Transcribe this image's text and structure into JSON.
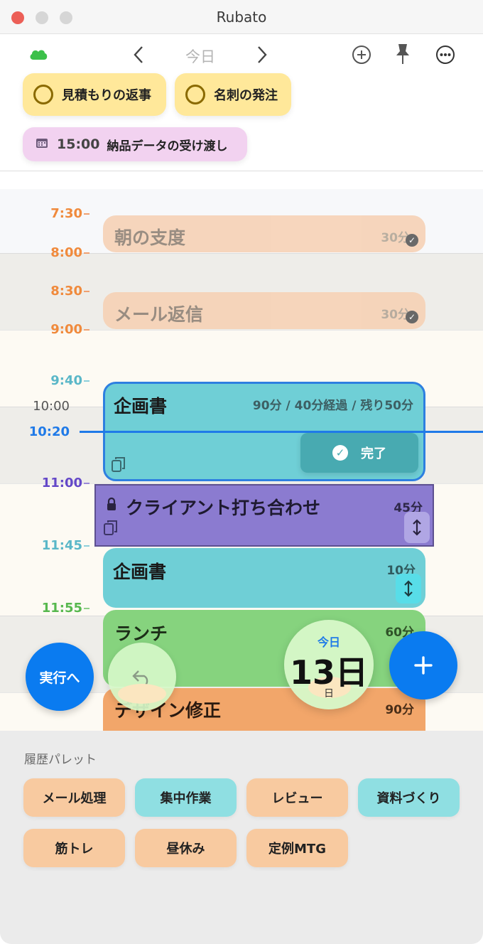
{
  "window": {
    "title": "Rubato"
  },
  "toolbar": {
    "date_label": "今日",
    "prev_icon": "chevron-left-icon",
    "next_icon": "chevron-right-icon"
  },
  "todos": [
    {
      "label": "見積もりの返事"
    },
    {
      "label": "名刺の発注"
    }
  ],
  "scheduled": {
    "time": "15:00",
    "label": "納品データの受け渡し"
  },
  "time_labels": {
    "t0730": "7:30",
    "t0800": "8:00",
    "t0830": "8:30",
    "t0900": "9:00",
    "t0940": "9:40",
    "t1000": "10:00",
    "t1020": "10:20",
    "t1100": "11:00",
    "t1145": "11:45",
    "t1155": "11:55"
  },
  "events": {
    "breakfast": {
      "title": "朝の支度",
      "duration": "30分"
    },
    "mail": {
      "title": "メール返信",
      "duration": "30分"
    },
    "plan": {
      "title": "企画書",
      "status": "90分 / 40分経過 / 残り50分",
      "done_label": "完了"
    },
    "client": {
      "title": "クライアント打ち合わせ",
      "duration": "45分"
    },
    "plan2": {
      "title": "企画書",
      "duration": "10分"
    },
    "lunch": {
      "title": "ランチ",
      "duration": "60分"
    },
    "design": {
      "title": "デザイン修正",
      "duration": "90分"
    }
  },
  "actions": {
    "run_label": "実行へ",
    "date_top": "今日",
    "date_day": "13日",
    "date_weekday": "日"
  },
  "palette": {
    "title": "履歴パレット",
    "items": [
      "メール処理",
      "集中作業",
      "レビュー",
      "資料づくり",
      "筋トレ",
      "昼休み",
      "定例MTG"
    ]
  },
  "colors": {
    "accent_blue": "#1f7ae8",
    "todo_yellow": "#ffe89a",
    "event_orange": "#f8caa0",
    "event_teal": "#6fd0d6",
    "event_purple": "#8b7bd0",
    "event_green": "#86d37e"
  }
}
